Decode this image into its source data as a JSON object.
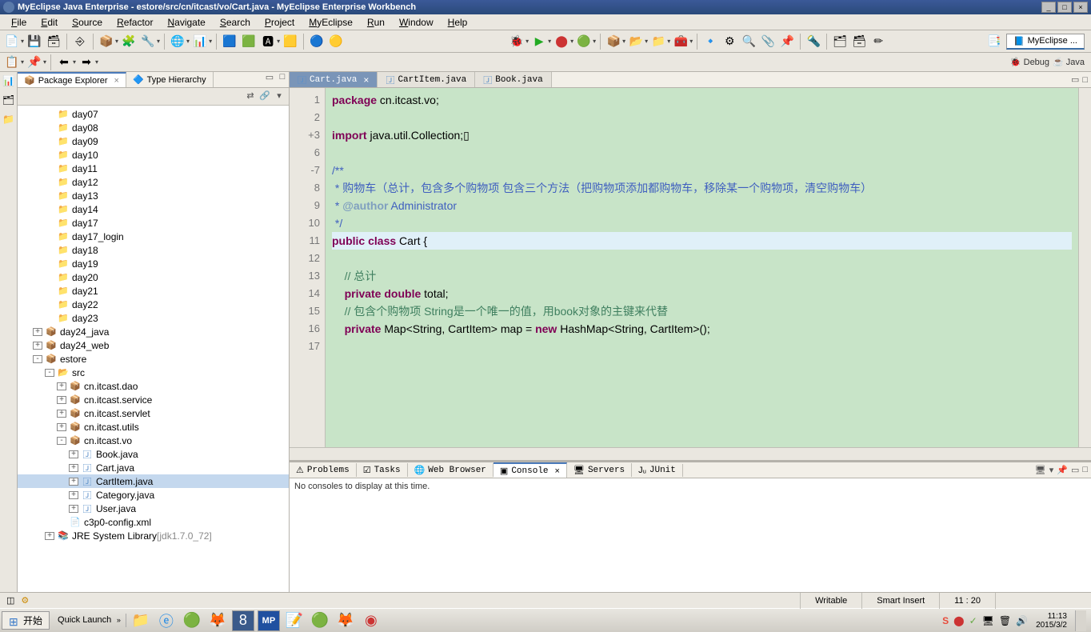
{
  "titleBar": {
    "text": "MyEclipse Java Enterprise - estore/src/cn/itcast/vo/Cart.java - MyEclipse Enterprise Workbench"
  },
  "menu": [
    "File",
    "Edit",
    "Source",
    "Refactor",
    "Navigate",
    "Search",
    "Project",
    "MyEclipse",
    "Run",
    "Window",
    "Help"
  ],
  "perspectives": {
    "main": "MyEclipse ...",
    "links": [
      "Debug",
      "Java"
    ]
  },
  "packageExplorer": {
    "tabs": [
      {
        "label": "Package Explorer",
        "active": true
      },
      {
        "label": "Type Hierarchy",
        "active": false
      }
    ],
    "tree": [
      {
        "indent": 2,
        "icon": "folder",
        "label": "day07"
      },
      {
        "indent": 2,
        "icon": "folder",
        "label": "day08"
      },
      {
        "indent": 2,
        "icon": "folder",
        "label": "day09"
      },
      {
        "indent": 2,
        "icon": "folder",
        "label": "day10"
      },
      {
        "indent": 2,
        "icon": "folder",
        "label": "day11"
      },
      {
        "indent": 2,
        "icon": "folder",
        "label": "day12"
      },
      {
        "indent": 2,
        "icon": "folder",
        "label": "day13"
      },
      {
        "indent": 2,
        "icon": "folder",
        "label": "day14"
      },
      {
        "indent": 2,
        "icon": "folder",
        "label": "day17"
      },
      {
        "indent": 2,
        "icon": "folder",
        "label": "day17_login"
      },
      {
        "indent": 2,
        "icon": "folder",
        "label": "day18"
      },
      {
        "indent": 2,
        "icon": "folder",
        "label": "day19"
      },
      {
        "indent": 2,
        "icon": "folder",
        "label": "day20"
      },
      {
        "indent": 2,
        "icon": "folder",
        "label": "day21"
      },
      {
        "indent": 2,
        "icon": "folder",
        "label": "day22"
      },
      {
        "indent": 2,
        "icon": "folder",
        "label": "day23"
      },
      {
        "indent": 1,
        "toggle": "+",
        "icon": "project",
        "label": "day24_java"
      },
      {
        "indent": 1,
        "toggle": "+",
        "icon": "project",
        "label": "day24_web"
      },
      {
        "indent": 1,
        "toggle": "-",
        "icon": "project",
        "label": "estore"
      },
      {
        "indent": 2,
        "toggle": "-",
        "icon": "src",
        "label": "src"
      },
      {
        "indent": 3,
        "toggle": "+",
        "icon": "package",
        "label": "cn.itcast.dao"
      },
      {
        "indent": 3,
        "toggle": "+",
        "icon": "package",
        "label": "cn.itcast.service"
      },
      {
        "indent": 3,
        "toggle": "+",
        "icon": "package",
        "label": "cn.itcast.servlet"
      },
      {
        "indent": 3,
        "toggle": "+",
        "icon": "package",
        "label": "cn.itcast.utils"
      },
      {
        "indent": 3,
        "toggle": "-",
        "icon": "package",
        "label": "cn.itcast.vo"
      },
      {
        "indent": 4,
        "toggle": "+",
        "icon": "java",
        "label": "Book.java"
      },
      {
        "indent": 4,
        "toggle": "+",
        "icon": "java",
        "label": "Cart.java"
      },
      {
        "indent": 4,
        "toggle": "+",
        "icon": "java",
        "label": "CartItem.java",
        "selected": true
      },
      {
        "indent": 4,
        "toggle": "+",
        "icon": "java",
        "label": "Category.java"
      },
      {
        "indent": 4,
        "toggle": "+",
        "icon": "java",
        "label": "User.java"
      },
      {
        "indent": 3,
        "icon": "xml",
        "label": "c3p0-config.xml"
      },
      {
        "indent": 2,
        "toggle": "+",
        "icon": "lib",
        "label": "JRE System Library",
        "suffix": "[jdk1.7.0_72]"
      }
    ]
  },
  "editor": {
    "tabs": [
      {
        "label": "Cart.java",
        "active": true
      },
      {
        "label": "CartItem.java",
        "active": false
      },
      {
        "label": "Book.java",
        "active": false
      }
    ],
    "lines": [
      {
        "n": 1,
        "html": "<span class='kw'>package</span> cn.itcast.vo;"
      },
      {
        "n": 2,
        "html": ""
      },
      {
        "n": 3,
        "marker": "+",
        "html": "<span class='kw'>import</span> java.util.Collection;▯"
      },
      {
        "n": 6,
        "html": ""
      },
      {
        "n": 7,
        "marker": "-",
        "html": "<span class='jd'>/**</span>"
      },
      {
        "n": 8,
        "html": "<span class='jd'> * 购物车（总计，包含多个购物项 包含三个方法（把购物项添加都购物车，移除某一个购物项，清空购物车）</span>"
      },
      {
        "n": 9,
        "html": "<span class='jd'> * <span class='jdtag'>@author</span> Administrator</span>"
      },
      {
        "n": 10,
        "html": "<span class='jd'> */</span>"
      },
      {
        "n": 11,
        "current": true,
        "html": "<span class='kw'>public</span> <span class='kw'>class</span> Cart {"
      },
      {
        "n": 12,
        "html": ""
      },
      {
        "n": 13,
        "html": "    <span class='cm'>// 总计</span>"
      },
      {
        "n": 14,
        "html": "    <span class='kw'>private</span> <span class='kw'>double</span> total;"
      },
      {
        "n": 15,
        "html": "    <span class='cm'>// 包含个购物项 String是一个唯一的值，用book对象的主键来代替</span>"
      },
      {
        "n": 16,
        "html": "    <span class='kw'>private</span> Map&lt;String, CartItem&gt; map = <span class='kw'>new</span> HashMap&lt;String, CartItem&gt;();"
      },
      {
        "n": 17,
        "html": ""
      }
    ]
  },
  "bottomView": {
    "tabs": [
      "Problems",
      "Tasks",
      "Web Browser",
      "Console",
      "Servers",
      "JUnit"
    ],
    "activeTab": "Console",
    "message": "No consoles to display at this time."
  },
  "statusBar": {
    "writable": "Writable",
    "insert": "Smart Insert",
    "position": "11 : 20"
  },
  "taskbar": {
    "start": "开始",
    "quickLaunch": "Quick Launch",
    "time": "11:13",
    "date": "2015/3/2"
  }
}
